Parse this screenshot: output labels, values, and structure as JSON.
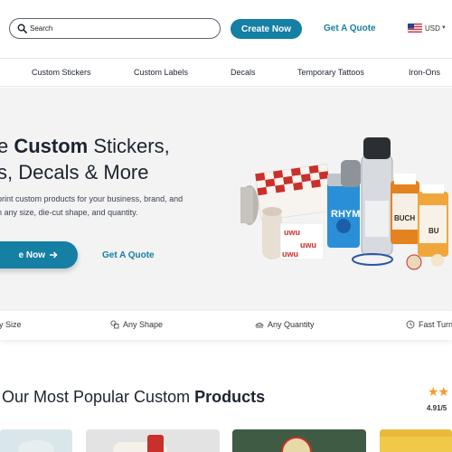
{
  "header": {
    "search_placeholder": "Search",
    "create_label": "Create Now",
    "quote_label": "Get A Quote",
    "currency_label": "USD",
    "currency_flag": "us-flag-icon"
  },
  "nav": {
    "items": [
      {
        "label": "Custom Stickers"
      },
      {
        "label": "Custom Labels"
      },
      {
        "label": "Decals"
      },
      {
        "label": "Temporary Tattoos"
      },
      {
        "label": "Iron-Ons"
      }
    ]
  },
  "hero": {
    "title_line1_prefix": "e ",
    "title_line1_bold": "Custom",
    "title_line1_suffix": " Stickers,",
    "title_line2": "s, Decals & More",
    "subtitle_line1": "print custom products for your business, brand, and",
    "subtitle_line2": "n any size, die-cut shape, and quantity.",
    "cta_label": "e Now",
    "cta_icon": "arrow-right-icon",
    "quote_label": "Get A Quote"
  },
  "features": [
    {
      "label": "y Size",
      "icon": "ruler-icon"
    },
    {
      "label": "Any Shape",
      "icon": "shapes-icon"
    },
    {
      "label": "Any Quantity",
      "icon": "stack-icon"
    },
    {
      "label": "Fast Turn",
      "icon": "clock-icon"
    }
  ],
  "popular": {
    "title_prefix": "Our Most Popular Custom ",
    "title_bold": "Products",
    "stars_shown": 2,
    "rating": "4.91/5"
  },
  "colors": {
    "brand": "#157fa4",
    "star": "#f39c2a",
    "hero_bg": "#f3f3f3"
  }
}
